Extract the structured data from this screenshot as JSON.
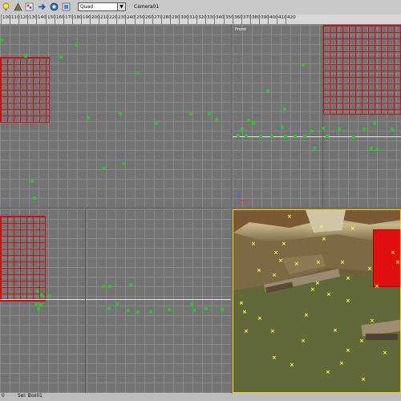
{
  "toolbar": {
    "icons": [
      "light-bulb-icon",
      "render-setup-icon",
      "material-editor-icon",
      "arrow-right-icon",
      "render-icon",
      "frame-icon"
    ],
    "view_select_value": "Quad",
    "camera_label": "Camera01"
  },
  "ruler": {
    "ticks": [
      "100",
      "110",
      "120",
      "130",
      "140",
      "150",
      "160",
      "170",
      "180",
      "190",
      "200",
      "210",
      "220",
      "230",
      "240",
      "250",
      "260",
      "270",
      "280",
      "290",
      "300",
      "310",
      "320",
      "330",
      "340",
      "350",
      "360",
      "370",
      "380",
      "390",
      "400",
      "410",
      "420"
    ]
  },
  "viewports": {
    "top_right_label": "Front"
  },
  "statusbar": {
    "left_value": "0",
    "selection_label": "Sel: Box01"
  },
  "colors": {
    "point_green": "#28c828",
    "track_yellow": "#ffff40",
    "object_red": "#e01010",
    "active_border": "#ffd400"
  }
}
